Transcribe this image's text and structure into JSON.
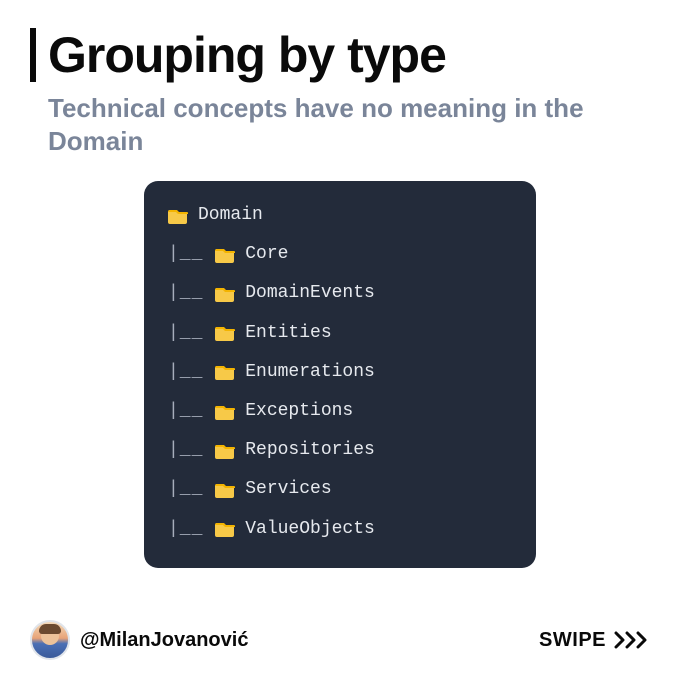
{
  "title": "Grouping by type",
  "subtitle": "Technical concepts have no meaning in the Domain",
  "tree": {
    "root": "Domain",
    "children": [
      "Core",
      "DomainEvents",
      "Entities",
      "Enumerations",
      "Exceptions",
      "Repositories",
      "Services",
      "ValueObjects"
    ],
    "childPrefix": "|__ "
  },
  "author": {
    "handle": "@MilanJovanović"
  },
  "footer": {
    "swipeLabel": "SWIPE"
  },
  "colors": {
    "folderIcon": "#f7c948",
    "codeBg": "#232b3a",
    "subtitle": "#7a8599"
  }
}
